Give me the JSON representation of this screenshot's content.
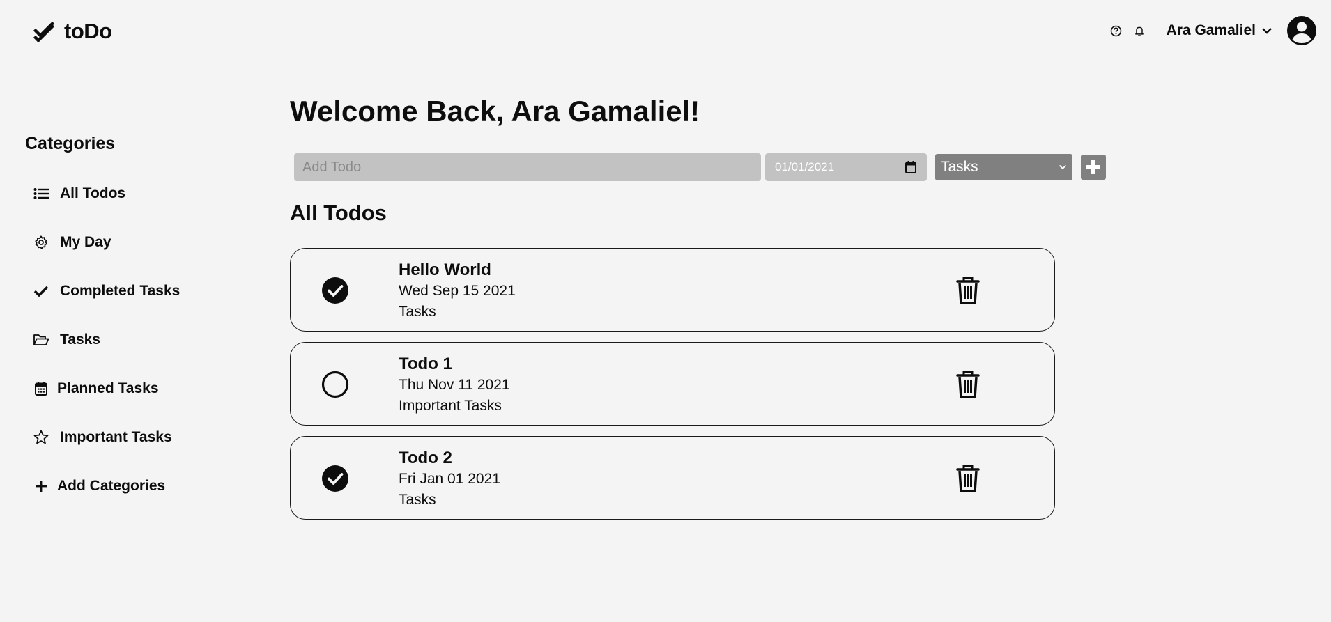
{
  "app": {
    "brand": "toDo"
  },
  "header": {
    "user_name": "Ara Gamaliel"
  },
  "sidebar": {
    "title": "Categories",
    "items": [
      {
        "label": "All Todos",
        "icon": "list-icon"
      },
      {
        "label": "My Day",
        "icon": "gear-icon"
      },
      {
        "label": "Completed Tasks",
        "icon": "check-icon"
      },
      {
        "label": "Tasks",
        "icon": "folder-open-icon"
      },
      {
        "label": "Planned Tasks",
        "icon": "calendar-icon"
      },
      {
        "label": "Important Tasks",
        "icon": "star-icon"
      },
      {
        "label": "Add Categories",
        "icon": "plus-icon"
      }
    ]
  },
  "main": {
    "welcome": "Welcome Back, Ara Gamaliel!",
    "add_form": {
      "placeholder": "Add Todo",
      "date_value": "01/01/2021",
      "category_selected": "Tasks"
    },
    "section_title": "All Todos",
    "todos": [
      {
        "title": "Hello World",
        "date": "Wed Sep 15 2021",
        "category": "Tasks",
        "completed": true
      },
      {
        "title": "Todo 1",
        "date": "Thu Nov 11 2021",
        "category": "Important Tasks",
        "completed": false
      },
      {
        "title": "Todo 2",
        "date": "Fri Jan 01 2021",
        "category": "Tasks",
        "completed": true
      }
    ]
  },
  "colors": {
    "background": "#f4f4f4",
    "input_bg": "#c2c2c2",
    "select_bg": "#808080",
    "text": "#0d0d0d"
  }
}
